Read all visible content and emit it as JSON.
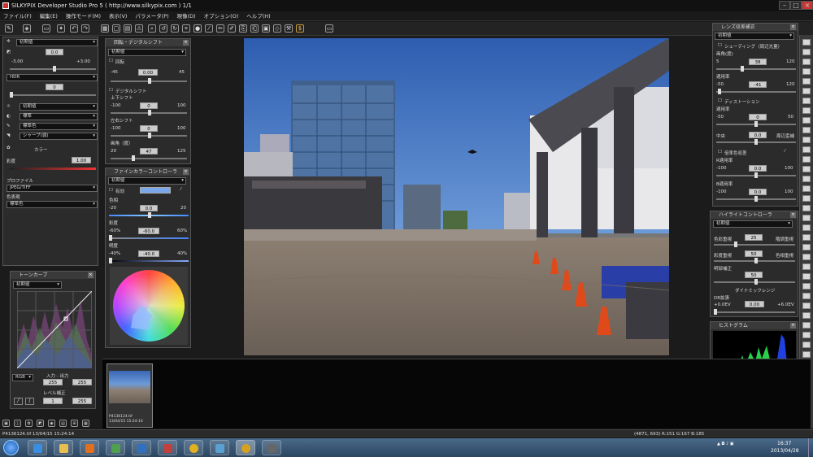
{
  "window": {
    "title": "SILKYPIX Developer Studio Pro 5 ( http://www.silkypix.com )   1/1"
  },
  "menu": [
    "ファイル(F)",
    "編集(E)",
    "操作モード(M)",
    "表示(V)",
    "パラメータ(P)",
    "現像(D)",
    "オプション(O)",
    "ヘルプ(H)"
  ],
  "left": {
    "exposure": {
      "value": "0.0",
      "min": "-3.00",
      "max": "+3.00",
      "preset": "初期値"
    },
    "hdr": {
      "label": "HDR",
      "value": "0"
    },
    "wb": "初期値",
    "tone": "標準",
    "color": "標準色",
    "sharp": "シャープ(弱)",
    "color_section": "カラー",
    "saturation_label": "彩度",
    "saturation_value": "1.00",
    "profile_label": "プロファイル",
    "profile_value": "JPEG/TIFF",
    "colorspace_label": "色表現",
    "colorspace_value": "標準色",
    "tonecurve": {
      "title": "トーンカーブ",
      "preset": "初期値",
      "channel": "RGB",
      "io_label": "入力 - 出力",
      "in": "255",
      "out": "255",
      "level_label": "レベル補正",
      "level_low": "1",
      "level_high": "255"
    }
  },
  "mid": {
    "rotate": {
      "title": "回転・デジタルシフト",
      "preset": "初期値",
      "label": "回転",
      "value": "0.00",
      "min": "-45",
      "max": "45"
    },
    "shift": {
      "label": "デジタルシフト",
      "ud_label": "上下シフト",
      "ud_value": "0",
      "lr_label": "左右シフト",
      "lr_value": "0",
      "angle_label": "画角（度）",
      "angle_value": "47",
      "min": "-100",
      "max": "100",
      "angle_min": "20",
      "angle_max": "125"
    },
    "fine": {
      "title": "ファインカラーコントローラ",
      "preset": "初期値",
      "enable": "有効",
      "hue_label": "色相",
      "hue_value": "0.0",
      "hue_min": "-20",
      "hue_max": "20",
      "sat_label": "彩度",
      "sat_value": "-60.0",
      "sat_min": "-60%",
      "sat_max": "60%",
      "bri_label": "明度",
      "bri_value": "-40.0",
      "bri_min": "-40%",
      "bri_max": "40%"
    }
  },
  "right": {
    "lens": {
      "title": "レンズ収差補正",
      "preset": "初期値",
      "shading": "シェーディング（周辺光量）",
      "amount_label": "画角(度)",
      "amount_value": "38",
      "amount_min": "5",
      "amount_max": "120",
      "rate_label": "適用率",
      "rate_value": "-41",
      "rate_min": "-50",
      "rate_max": "120",
      "dist": "ディストーション",
      "dist_rate_label": "適用率",
      "dist_rate": "0",
      "dist_min": "-50",
      "dist_max": "50",
      "center_label": "中央",
      "center_value": "0.0",
      "edge_label": "周辺歪補",
      "ca": "倍率色収差",
      "r_label": "R適用率",
      "r_value": "0.0",
      "b_label": "B適用率",
      "b_value": "0.0",
      "ca_min": "-100",
      "ca_max": "100"
    },
    "highlight": {
      "title": "ハイライトコントローラ",
      "preset": "初期値",
      "hl_label": "色彩重視",
      "hl_right": "階調重視",
      "hl_value": "25",
      "sat_label": "彩度重視",
      "sat_right": "色相重視",
      "sat_value": "50",
      "dark_label": "明部補正",
      "dark_value": "50",
      "dr_title": "ダイナミックレンジ",
      "dr_label": "DR拡張",
      "dr_value": "0.00",
      "dr_min": "+0.0EV",
      "dr_max": "+6.0EV"
    },
    "histogram": {
      "title": "ヒストグラム"
    }
  },
  "filmstrip": {
    "filename": "P4136124.tif",
    "date": "13/04/15 15:24:14"
  },
  "status": {
    "left": "P4136124.tif 13/04/15 15:24:14",
    "right": "(4871, 693) R:151 G:167 B:185"
  },
  "taskbar": {
    "time": "16:37",
    "date": "2013/04/28"
  },
  "colors": {
    "accent": "#d03030",
    "panel_bg": "#2b2b2b"
  }
}
